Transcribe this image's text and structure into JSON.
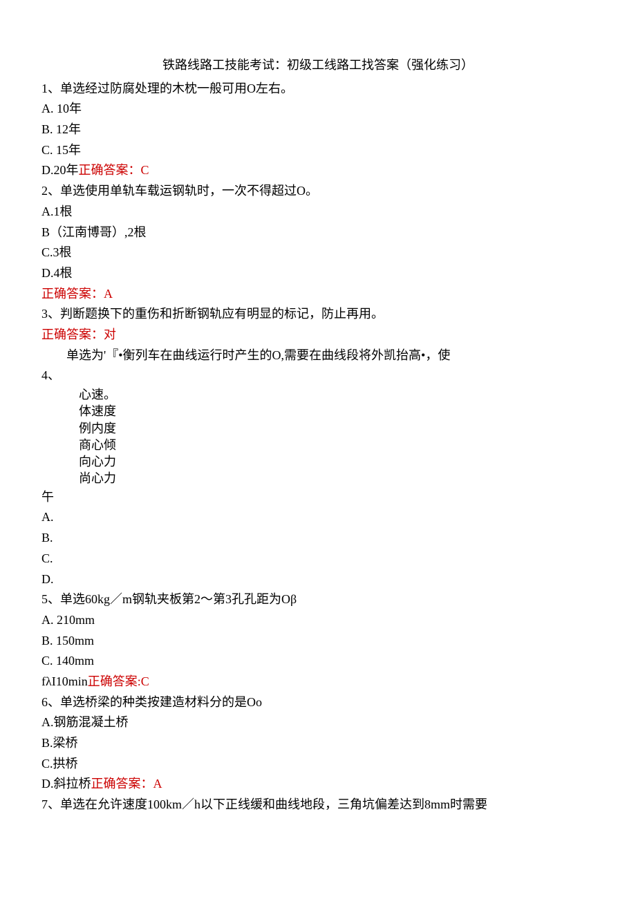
{
  "title": "铁路线路工技能考试：初级工线路工找答案（强化练习）",
  "lines": {
    "q1": "1、单选经过防腐处理的木枕一般可用O左右。",
    "q1a": "A. 10年",
    "q1b": "B. 12年",
    "q1c": "C. 15年",
    "q1d_prefix": "D.20年",
    "q1d_answer": "正确答案：C",
    "q2": "2、单选使用单轨车载运钢轨时，一次不得超过O。",
    "q2a": "A.1根",
    "q2b": "B（江南博哥）,2根",
    "q2c": "C.3根",
    "q2d": "D.4根",
    "q2_answer": "正确答案：A",
    "q3": "3、判断题换下的重伤和折断钢轨应有明显的标记，防止再用。",
    "q3_answer": "正确答案：对",
    "q4_text": "单选为'『•衡列车在曲线运行时产生的O,需要在曲线段将外凯抬高•，使",
    "q4_num": "4、",
    "q4_v1": "心速。",
    "q4_v2": "体速度",
    "q4_v3": "例内度",
    "q4_v4": "商心倾",
    "q4_v5": "向心力",
    "q4_v6": "尚心力",
    "q4_wu": "午",
    "q4a": "A.",
    "q4b": "B.",
    "q4c": "C.",
    "q4d": "D.",
    "q5": "5、单选60kg／m钢轨夹板第2～第3孔孔距为Oβ",
    "q5a": "A. 210mm",
    "q5b": "B. 150mm",
    "q5c": "C. 140mm",
    "q5d_prefix": "fλI10min",
    "q5d_answer": "正确答案:C",
    "q6": "6、单选桥梁的种类按建造材料分的是Oo",
    "q6a": "A.钢筋混凝土桥",
    "q6b": "B.梁桥",
    "q6c": "C.拱桥",
    "q6d_prefix": "D.斜拉桥",
    "q6d_answer": "正确答案：A",
    "q7": "7、单选在允许速度100km／h以下正线缓和曲线地段，三角坑偏差达到8mm时需要"
  }
}
